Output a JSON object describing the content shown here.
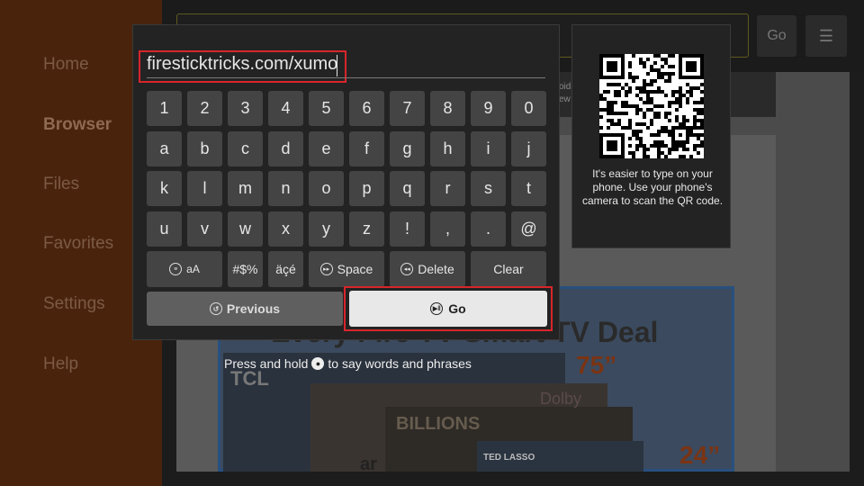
{
  "sidebar": {
    "items": [
      {
        "label": "Home"
      },
      {
        "label": "Browser"
      },
      {
        "label": "Files"
      },
      {
        "label": "Favorites"
      },
      {
        "label": "Settings"
      },
      {
        "label": "Help"
      }
    ],
    "active": "Browser"
  },
  "toolbar": {
    "go_label": "Go",
    "menu_icon": "menu-icon"
  },
  "webpage": {
    "snippet_lines": [
      "oid",
      "ew"
    ],
    "banner_title": "Every Fire TV Smart TV Deal",
    "banner_75": "75”",
    "banner_24": "24”",
    "banner_tcl": "TCL",
    "banner_dolby": "Dolby",
    "banner_billions": "BILLIONS",
    "banner_ted": "TED LASSO",
    "banner_ar": "ar"
  },
  "keyboard": {
    "input_value": "firesticktricks.com/xumo",
    "rows": [
      [
        "1",
        "2",
        "3",
        "4",
        "5",
        "6",
        "7",
        "8",
        "9",
        "0"
      ],
      [
        "a",
        "b",
        "c",
        "d",
        "e",
        "f",
        "g",
        "h",
        "i",
        "j"
      ],
      [
        "k",
        "l",
        "m",
        "n",
        "o",
        "p",
        "q",
        "r",
        "s",
        "t"
      ],
      [
        "u",
        "v",
        "w",
        "x",
        "y",
        "z",
        "!",
        ",",
        ".",
        "@"
      ]
    ],
    "function_row": {
      "case_label": "aA",
      "symbols_label": "#$%",
      "accents_label": "äçé",
      "space_label": "Space",
      "delete_label": "Delete",
      "clear_label": "Clear"
    },
    "previous_label": "Previous",
    "go_label": "Go",
    "hint_before": "Press and hold",
    "hint_after": "to say words and phrases"
  },
  "qr_panel": {
    "text": "It's easier to type on your phone. Use your phone's camera to scan the QR code."
  },
  "colors": {
    "highlight": "#d7262b",
    "sidebar_bg": "#4a230d",
    "key_bg": "#444444",
    "panel_bg": "#232323"
  }
}
